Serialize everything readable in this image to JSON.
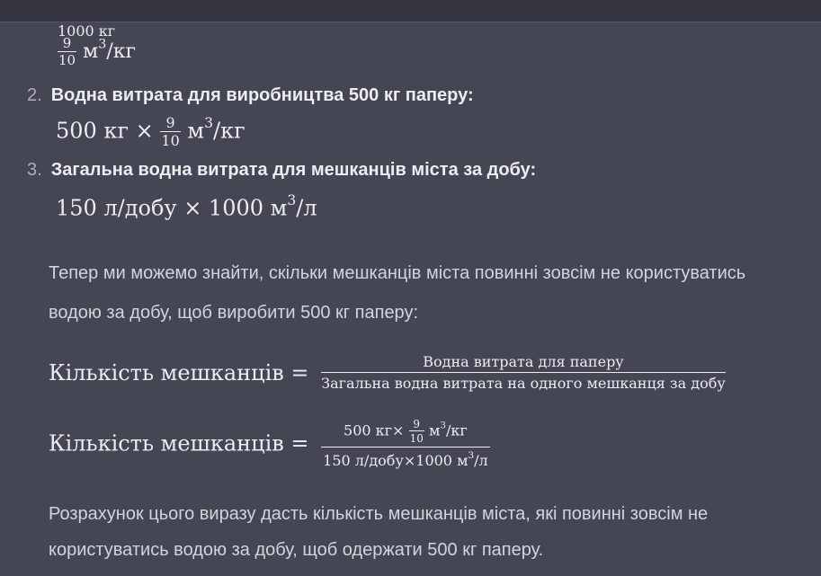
{
  "top_fraction": {
    "numerator": "1000 кг",
    "mini_num": "9",
    "mini_den": "10",
    "unit_a": "м",
    "unit_exp": "3",
    "unit_b": "/кг"
  },
  "items": [
    {
      "number": "2.",
      "title": "Водна витрата для виробництва 500 кг паперу:",
      "formula": {
        "lead": "500 кг ×",
        "frac_num": "9",
        "frac_den": "10",
        "unit_a": "м",
        "unit_exp": "3",
        "unit_b": "/кг"
      }
    },
    {
      "number": "3.",
      "title": "Загальна водна витрата для мешканців міста за добу:",
      "formula": {
        "lead": "150 л/добу × 1000 м",
        "unit_exp": "3",
        "unit_b": "/л"
      }
    }
  ],
  "paragraph1": {
    "line1": "Тепер ми можемо знайти, скільки мешканців міста повинні зовсім не користуватись",
    "line2": "водою за добу, щоб виробити 500 кг паперу:"
  },
  "equation1": {
    "lhs": "Кількість мешканців =",
    "numerator": "Водна витрата для паперу",
    "denominator": "Загальна водна витрата на одного мешканця за добу"
  },
  "equation2": {
    "lhs": "Кількість мешканців =",
    "num_lead": "500 кг×",
    "num_frac_num": "9",
    "num_frac_den": "10",
    "num_unit_a": "м",
    "num_unit_exp": "3",
    "num_unit_b": "/кг",
    "den_lead": "150 л/добу×1000 м",
    "den_unit_exp": "3",
    "den_unit_b": "/л"
  },
  "paragraph2": {
    "line1": "Розрахунок цього виразу дасть кількість мешканців міста, які повинні зовсім не",
    "line2": "користуватись водою за добу, щоб одержати 500 кг паперу."
  }
}
